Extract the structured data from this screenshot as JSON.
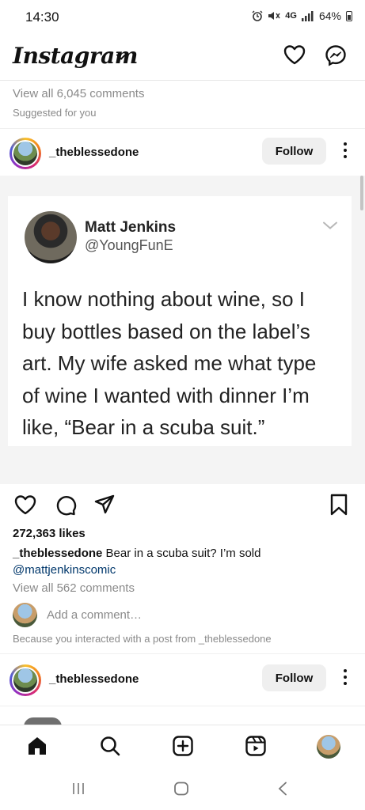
{
  "status_bar": {
    "time": "14:30",
    "network": "4G",
    "battery": "64%",
    "icons": [
      "alarm-icon",
      "mute-icon",
      "signal-icon",
      "battery-icon"
    ]
  },
  "header": {
    "logo": "Instagram",
    "icons": [
      "chevron-down-icon",
      "heart-icon",
      "messenger-icon"
    ]
  },
  "feed_top": {
    "view_all_comments": "View all 6,045 comments",
    "suggested": "Suggested for you"
  },
  "post": {
    "username": "_theblessedone",
    "follow_label": "Follow",
    "tweet": {
      "name": "Matt Jenkins",
      "handle": "@YoungFunE",
      "lines": [
        "I know nothing about wine, so I",
        "buy bottles based on the label’s",
        "art. My wife asked me what type",
        "of wine I wanted with dinner I’m",
        "like, “Bear in a scuba suit.”"
      ]
    },
    "likes": "272,363 likes",
    "caption_user": "_theblessedone",
    "caption_text": " Bear in a scuba suit? I’m sold",
    "caption_mention": "@mattjenkinscomic",
    "view_all_comments": "View all 562 comments",
    "add_comment_placeholder": "Add a comment…",
    "because": "Because you interacted with a post from _theblessedone"
  },
  "next_post": {
    "username": "_theblessedone",
    "follow_label": "Follow"
  },
  "bottom_nav": [
    "home-icon",
    "search-icon",
    "create-icon",
    "reels-icon",
    "profile-avatar"
  ],
  "system_nav": [
    "recents-icon",
    "home-button-icon",
    "back-icon"
  ],
  "colors": {
    "link": "#00376b",
    "muted": "#8a8a8a",
    "follow_bg": "#efefef"
  }
}
